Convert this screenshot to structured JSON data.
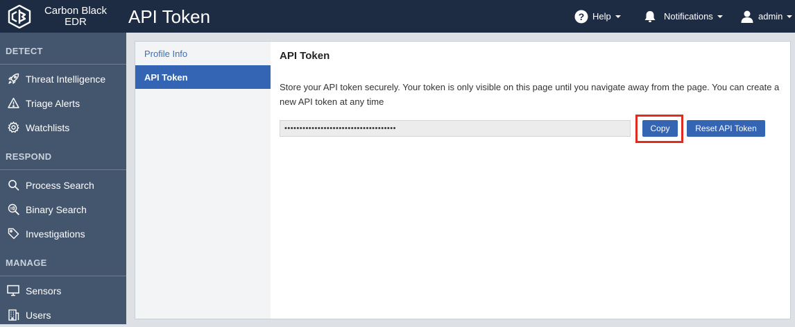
{
  "header": {
    "brand_line1": "Carbon Black",
    "brand_line2": "EDR",
    "page_title": "API Token",
    "help_label": "Help",
    "notifications_label": "Notifications",
    "user_label": "admin"
  },
  "sidebar": {
    "sections": [
      {
        "title": "DETECT",
        "items": [
          {
            "label": "Threat Intelligence",
            "icon": "rocket-icon"
          },
          {
            "label": "Triage Alerts",
            "icon": "warning-icon"
          },
          {
            "label": "Watchlists",
            "icon": "gear-icon"
          }
        ]
      },
      {
        "title": "RESPOND",
        "items": [
          {
            "label": "Process Search",
            "icon": "search-icon"
          },
          {
            "label": "Binary Search",
            "icon": "binary-search-icon"
          },
          {
            "label": "Investigations",
            "icon": "tag-icon"
          }
        ]
      },
      {
        "title": "MANAGE",
        "items": [
          {
            "label": "Sensors",
            "icon": "monitor-icon"
          },
          {
            "label": "Users",
            "icon": "building-icon"
          }
        ]
      }
    ]
  },
  "subnav": {
    "items": [
      {
        "label": "Profile Info",
        "active": false
      },
      {
        "label": "API Token",
        "active": true
      }
    ]
  },
  "content": {
    "title": "API Token",
    "description": "Store your API token securely. Your token is only visible on this page until you navigate away from the page. You can create a new API token at any time",
    "token_value": "•••••••••••••••••••••••••••••••••••••",
    "copy_label": "Copy",
    "reset_label": "Reset API Token"
  },
  "colors": {
    "header_bg": "#1e2c43",
    "sidebar_bg": "#44556e",
    "accent": "#3465b5",
    "highlight": "#e02b20"
  }
}
